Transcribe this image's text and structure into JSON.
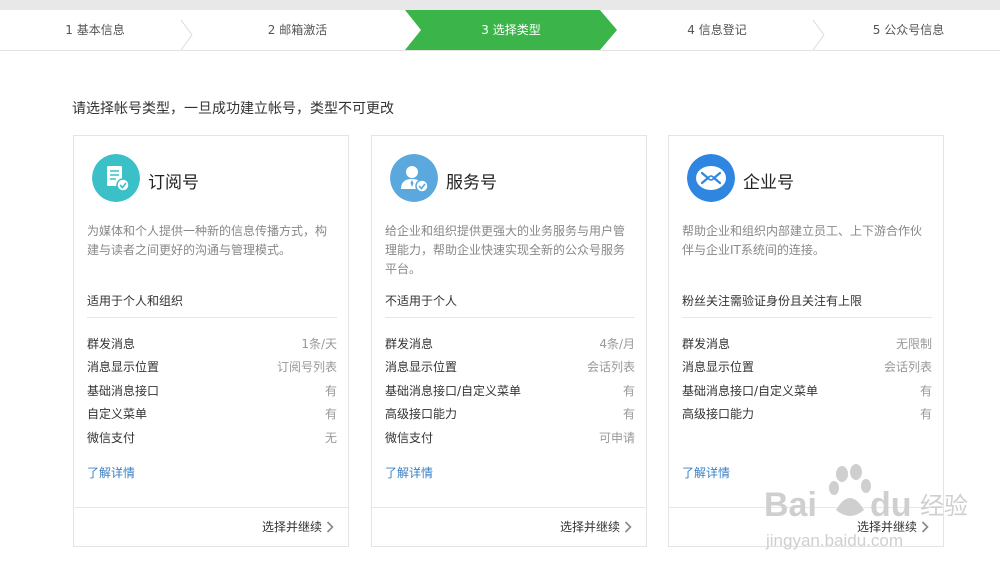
{
  "steps": [
    {
      "label": "1 基本信息"
    },
    {
      "label": "2 邮箱激活"
    },
    {
      "label": "3 选择类型"
    },
    {
      "label": "4 信息登记"
    },
    {
      "label": "5 公众号信息"
    }
  ],
  "instruction": "请选择帐号类型，一旦成功建立帐号，类型不可更改",
  "cards": [
    {
      "title": "订阅号",
      "description": "为媒体和个人提供一种新的信息传播方式，构建与读者之间更好的沟通与管理模式。",
      "note": "适用于个人和组织",
      "features": [
        {
          "name": "群发消息",
          "value": "1条/天"
        },
        {
          "name": "消息显示位置",
          "value": "订阅号列表"
        },
        {
          "name": "基础消息接口",
          "value": "有"
        },
        {
          "name": "自定义菜单",
          "value": "有"
        },
        {
          "name": "微信支付",
          "value": "无"
        }
      ],
      "more": "了解详情",
      "select": "选择并继续"
    },
    {
      "title": "服务号",
      "description": "给企业和组织提供更强大的业务服务与用户管理能力，帮助企业快速实现全新的公众号服务平台。",
      "note": "不适用于个人",
      "features": [
        {
          "name": "群发消息",
          "value": "4条/月"
        },
        {
          "name": "消息显示位置",
          "value": "会话列表"
        },
        {
          "name": "基础消息接口/自定义菜单",
          "value": "有"
        },
        {
          "name": "高级接口能力",
          "value": "有"
        },
        {
          "name": "微信支付",
          "value": "可申请"
        }
      ],
      "more": "了解详情",
      "select": "选择并继续"
    },
    {
      "title": "企业号",
      "description": "帮助企业和组织内部建立员工、上下游合作伙伴与企业IT系统间的连接。",
      "note": "粉丝关注需验证身份且关注有上限",
      "features": [
        {
          "name": "群发消息",
          "value": "无限制"
        },
        {
          "name": "消息显示位置",
          "value": "会话列表"
        },
        {
          "name": "基础消息接口/自定义菜单",
          "value": "有"
        },
        {
          "name": "高级接口能力",
          "value": "有"
        }
      ],
      "more": "了解详情",
      "select": "选择并继续"
    }
  ],
  "watermark": {
    "brand": "Bai du 经验",
    "site": "jingyan.baidu.com"
  },
  "colors": {
    "active_step": "#3bb54a",
    "subscription_icon": "#3cc0c7",
    "service_icon": "#5aa8dd",
    "enterprise_icon": "#2f86e0",
    "link": "#3a7fc4"
  },
  "icons": {
    "subscription": "document-check-icon",
    "service": "user-check-icon",
    "enterprise": "enterprise-link-icon",
    "select": "chevron-right-icon"
  }
}
